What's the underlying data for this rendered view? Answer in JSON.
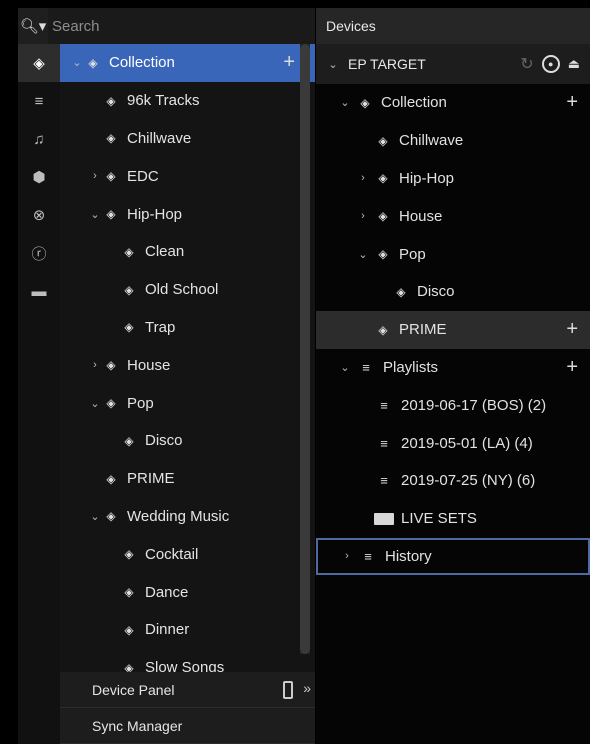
{
  "search": {
    "placeholder": "Search"
  },
  "left_tree": [
    {
      "label": "Collection",
      "depth": 0,
      "chevron": "⌄",
      "selected": true,
      "plus": "+"
    },
    {
      "label": "96k Tracks",
      "depth": 1
    },
    {
      "label": "Chillwave",
      "depth": 1
    },
    {
      "label": "EDC",
      "depth": 1,
      "chevron": "›"
    },
    {
      "label": "Hip-Hop",
      "depth": 1,
      "chevron": "⌄"
    },
    {
      "label": "Clean",
      "depth": 2
    },
    {
      "label": "Old School",
      "depth": 2
    },
    {
      "label": "Trap",
      "depth": 2
    },
    {
      "label": "House",
      "depth": 1,
      "chevron": "›"
    },
    {
      "label": "Pop",
      "depth": 1,
      "chevron": "⌄"
    },
    {
      "label": "Disco",
      "depth": 2
    },
    {
      "label": "PRIME",
      "depth": 1
    },
    {
      "label": "Wedding Music",
      "depth": 1,
      "chevron": "⌄"
    },
    {
      "label": "Cocktail",
      "depth": 2
    },
    {
      "label": "Dance",
      "depth": 2
    },
    {
      "label": "Dinner",
      "depth": 2
    },
    {
      "label": "Slow Songs",
      "depth": 2
    }
  ],
  "bottom": {
    "device_panel": "Device Panel",
    "sync_manager": "Sync Manager",
    "expand_glyph": "»"
  },
  "devices": {
    "title": "Devices",
    "target": "EP TARGET"
  },
  "right_tree": [
    {
      "label": "Collection",
      "depth": 0,
      "chevron": "⌄",
      "icon": "cube",
      "plus": "+"
    },
    {
      "label": "Chillwave",
      "depth": 1,
      "icon": "cube"
    },
    {
      "label": "Hip-Hop",
      "depth": 1,
      "chevron": "›",
      "icon": "cube"
    },
    {
      "label": "House",
      "depth": 1,
      "chevron": "›",
      "icon": "cube"
    },
    {
      "label": "Pop",
      "depth": 1,
      "chevron": "⌄",
      "icon": "cube"
    },
    {
      "label": "Disco",
      "depth": 2,
      "icon": "cube"
    },
    {
      "label": "PRIME",
      "depth": 1,
      "icon": "cube",
      "plus": "+",
      "highlight": true
    },
    {
      "label": "Playlists",
      "depth": 0,
      "chevron": "⌄",
      "icon": "playlist",
      "plus": "+"
    },
    {
      "label": "2019-06-17 (BOS) (2)",
      "depth": 1,
      "icon": "playlist"
    },
    {
      "label": "2019-05-01 (LA) (4)",
      "depth": 1,
      "icon": "playlist"
    },
    {
      "label": "2019-07-25 (NY) (6)",
      "depth": 1,
      "icon": "playlist"
    },
    {
      "label": "LIVE SETS",
      "depth": 1,
      "icon": "folder"
    },
    {
      "label": "History",
      "depth": 0,
      "chevron": "›",
      "icon": "playlist",
      "outlined": true
    }
  ],
  "colors": {
    "selection": "#3a66b9",
    "outline": "#4e6aa0"
  }
}
